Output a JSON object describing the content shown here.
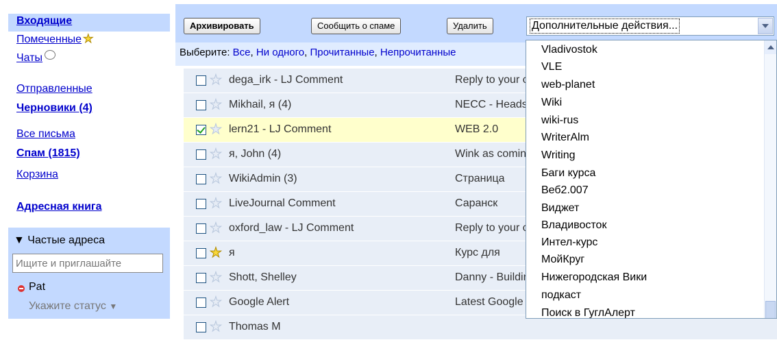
{
  "sidebar": {
    "inbox": "Входящие",
    "starred": "Помеченные",
    "chats": "Чаты",
    "sent": "Отправленные",
    "drafts": "Черновики (4)",
    "all_mail": "Все письма",
    "spam": "Спам (1815)",
    "trash": "Корзина",
    "contacts": "Адресная книга",
    "frequent": {
      "title": "Частые адреса",
      "search_placeholder": "Ищите и приглашайте",
      "contact_name": "Pat",
      "status": "Укажите статус"
    }
  },
  "toolbar": {
    "archive": "Архивировать",
    "report_spam": "Сообщить о спаме",
    "delete": "Удалить",
    "more_actions": "Дополнительные действия..."
  },
  "chooser": {
    "label": "Выберите:",
    "all": "Все",
    "none": "Ни одного",
    "read": "Прочитанные",
    "unread": "Непрочитанные"
  },
  "messages": [
    {
      "from": "dega_irk - LJ Comment",
      "subject": "Reply to your comment",
      "checked": false,
      "starred": false
    },
    {
      "from": "Mikhail, я (4)",
      "subject": "NECC - Heads up",
      "checked": false,
      "starred": false
    },
    {
      "from": "lern21 - LJ Comment",
      "subject": "WEB 2.0",
      "checked": true,
      "starred": false
    },
    {
      "from": "я, John (4)",
      "subject": "Wink as coming",
      "checked": false,
      "starred": false
    },
    {
      "from": "WikiAdmin (3)",
      "subject": "Страница",
      "checked": false,
      "starred": false
    },
    {
      "from": "LiveJournal Comment",
      "subject": "Саранск",
      "checked": false,
      "starred": false
    },
    {
      "from": "oxford_law - LJ Comment",
      "subject": "Reply to your comment",
      "checked": false,
      "starred": false
    },
    {
      "from": "я",
      "subject": "Курс для",
      "checked": false,
      "starred": true
    },
    {
      "from": "Shott, Shelley",
      "subject": "Danny - Building",
      "checked": false,
      "starred": false
    },
    {
      "from": "Google Alert",
      "subject": "Latest Google",
      "checked": false,
      "starred": false
    },
    {
      "from": "Thomas M",
      "subject": "",
      "checked": false,
      "starred": false
    }
  ],
  "dropdown": {
    "items": [
      "Vladivostok",
      "VLE",
      "web-planet",
      "Wiki",
      "wiki-rus",
      "WriterAlm",
      "Writing",
      "Баги курса",
      "Веб2.007",
      "Виджет",
      "Владивосток",
      "Интел-курс",
      "МойКруг",
      "Нижегородская Вики",
      "подкаст",
      "Поиск в ГуглАлерт"
    ]
  },
  "colors": {
    "nav_bg": "#c3d9ff",
    "link": "#0000cc",
    "read_row": "#e8eef7",
    "selected_row": "#ffffcc"
  }
}
